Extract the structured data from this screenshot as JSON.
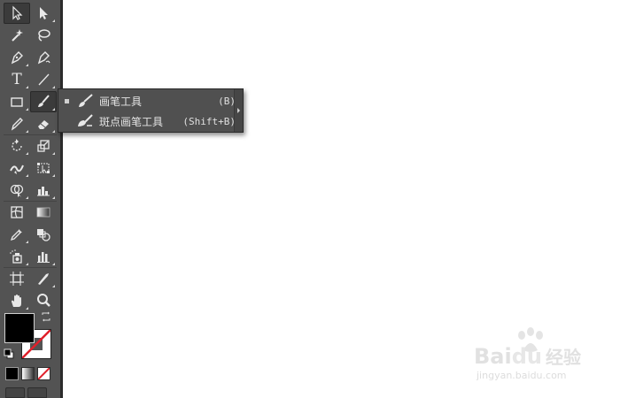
{
  "toolbar": {
    "tools": [
      [
        "selection-tool",
        "direct-selection-tool"
      ],
      [
        "magic-wand-tool",
        "lasso-tool"
      ],
      [
        "pen-tool",
        "curvature-tool"
      ],
      [
        "type-tool",
        "line-segment-tool"
      ],
      [
        "rectangle-tool",
        "paintbrush-tool"
      ],
      [
        "pencil-tool",
        "eraser-tool"
      ],
      [
        "rotate-tool",
        "scale-tool"
      ],
      [
        "width-tool",
        "free-transform-tool"
      ],
      [
        "shape-builder-tool",
        "perspective-grid-tool"
      ],
      [
        "mesh-tool",
        "gradient-tool"
      ],
      [
        "eyedropper-tool",
        "blend-tool"
      ],
      [
        "symbol-sprayer-tool",
        "column-graph-tool"
      ],
      [
        "artboard-tool",
        "slice-tool"
      ],
      [
        "hand-tool",
        "zoom-tool"
      ]
    ],
    "type_glyph": "T",
    "colors": {
      "panel_bg": "#535353",
      "fill": "#000000",
      "stroke": "#ffffff",
      "none_slash": "#e0202a"
    }
  },
  "flyout": {
    "items": [
      {
        "label": "画笔工具",
        "shortcut": "(B)",
        "selected": true,
        "icon": "paintbrush-icon"
      },
      {
        "label": "斑点画笔工具",
        "shortcut": "(Shift+B)",
        "selected": false,
        "icon": "blob-brush-icon"
      }
    ]
  },
  "watermark": {
    "logo": "Bai",
    "logo_du": "du",
    "logo_cn": "经验",
    "url": "jingyan.baidu.com"
  }
}
